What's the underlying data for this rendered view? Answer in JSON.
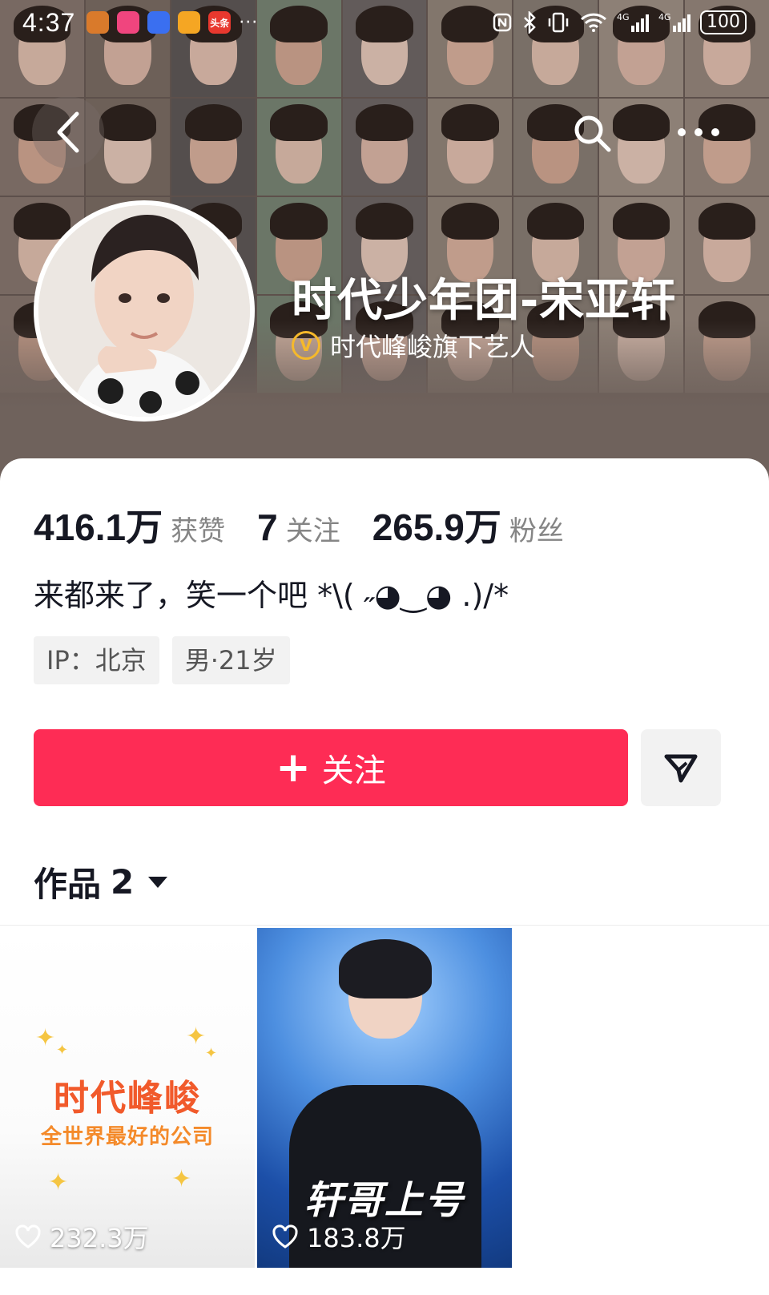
{
  "status_bar": {
    "time": "4:37",
    "notifications": [
      {
        "icon": "profile-app-icon",
        "color": "#d97a2b",
        "glyph": ""
      },
      {
        "icon": "pink-app-icon",
        "color": "#f0457e",
        "glyph": ""
      },
      {
        "icon": "blue-app-icon",
        "color": "#3a6ff0",
        "glyph": ""
      },
      {
        "icon": "orange-app-icon",
        "color": "#f5a623",
        "glyph": ""
      },
      {
        "icon": "toutiao-app-icon",
        "color": "#e8382e",
        "glyph": "头条"
      }
    ],
    "dots": "···",
    "battery": "100"
  },
  "profile": {
    "name": "时代少年团-宋亚轩",
    "verified_badge": "V",
    "verified_text": "时代峰峻旗下艺人"
  },
  "stats": [
    {
      "value": "416.1万",
      "label": "获赞"
    },
    {
      "value": "7",
      "label": "关注"
    },
    {
      "value": "265.9万",
      "label": "粉丝"
    }
  ],
  "bio": "来都来了，笑一个吧 *\\( ˶◕‿◕ .)/*",
  "tags": [
    "IP：北京",
    "男·21岁"
  ],
  "actions": {
    "follow_icon": "+",
    "follow_label": "关注"
  },
  "works": {
    "label": "作品",
    "count": "2"
  },
  "videos": [
    {
      "title": "时代峰峻",
      "subtitle": "全世界最好的公司",
      "likes": "232.3万"
    },
    {
      "title": "轩哥上号",
      "likes": "183.8万"
    }
  ],
  "colors": {
    "accent": "#fe2c55",
    "banner": "#6f625c",
    "verified": "#f5b92b"
  }
}
